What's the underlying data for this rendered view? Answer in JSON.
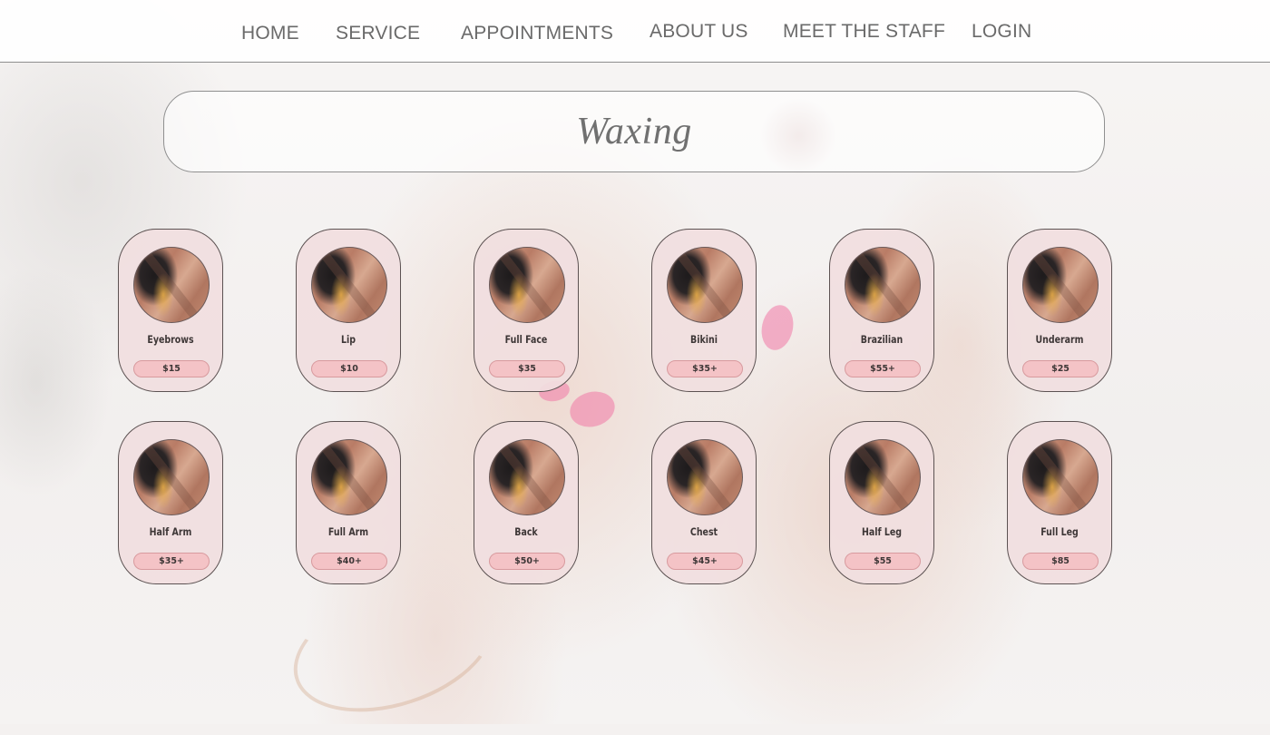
{
  "nav": {
    "home": "HOME",
    "service": "SERVICE",
    "appointments": "APPOINTMENTS",
    "about": "ABOUT US",
    "staff": "MEET THE STAFF",
    "login": "LOGIN"
  },
  "page": {
    "title": "Waxing"
  },
  "services": [
    {
      "name": "Eyebrows",
      "price": "$15"
    },
    {
      "name": "Lip",
      "price": "$10"
    },
    {
      "name": "Full Face",
      "price": "$35"
    },
    {
      "name": "Bikini",
      "price": "$35+"
    },
    {
      "name": "Brazilian",
      "price": "$55+"
    },
    {
      "name": "Underarm",
      "price": "$25"
    },
    {
      "name": "Half Arm",
      "price": "$35+"
    },
    {
      "name": "Full Arm",
      "price": "$40+"
    },
    {
      "name": "Back",
      "price": "$50+"
    },
    {
      "name": "Chest",
      "price": "$45+"
    },
    {
      "name": "Half Leg",
      "price": "$55"
    },
    {
      "name": "Full Leg",
      "price": "$85"
    }
  ],
  "colors": {
    "card_bg": "#f1dee0",
    "price_pill": "#f4c3c6",
    "nav_text": "#6a6a6a",
    "title_text": "#707070"
  }
}
